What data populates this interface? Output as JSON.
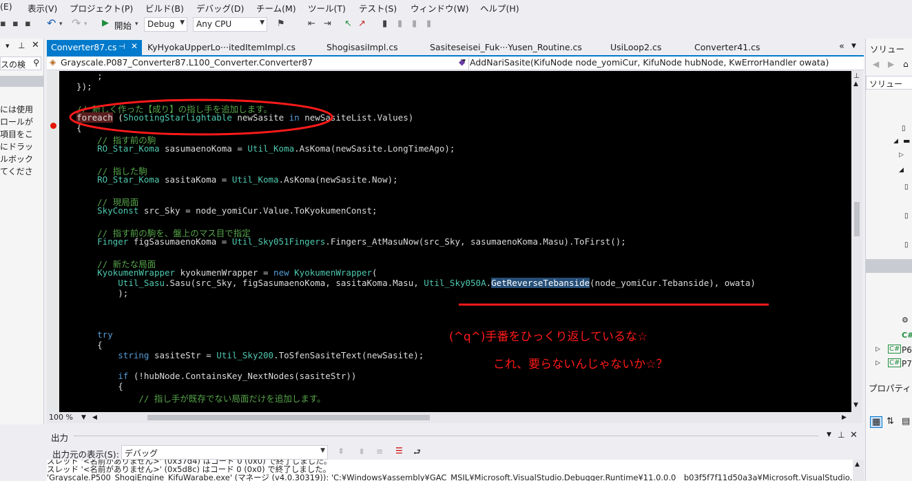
{
  "menu": {
    "items": [
      "(E)",
      "表示(V)",
      "プロジェクト(P)",
      "ビルド(B)",
      "デバッグ(D)",
      "チーム(M)",
      "ツール(T)",
      "テスト(S)",
      "ウィンドウ(W)",
      "ヘルプ(H)"
    ]
  },
  "toolbar": {
    "start_label": "開始",
    "config_value": "Debug",
    "platform_value": "Any CPU"
  },
  "left_panel": {
    "search_text": "スの検",
    "lines": [
      "には使用",
      "ロールが",
      "項目をこ",
      "にドラッ",
      "ルボック",
      "てくださ"
    ]
  },
  "tabs": [
    {
      "label": "Converter87.cs",
      "active": true
    },
    {
      "label": "KyHyokaUpperLo···itedItemImpl.cs",
      "active": false
    },
    {
      "label": "ShogisasiImpl.cs",
      "active": false
    },
    {
      "label": "Sasiteseisei_Fuk···Yusen_Routine.cs",
      "active": false
    },
    {
      "label": "UsiLoop2.cs",
      "active": false
    },
    {
      "label": "Converter41.cs",
      "active": false
    }
  ],
  "navbar": {
    "class_path": "Grayscale.P087_Converter87.L100_Converter.Converter87",
    "method": "AddNariSasite(KifuNode node_yomiCur, KifuNode hubNode, KwErrorHandler owata)"
  },
  "code_lines": [
    {
      "t": "      ;",
      "c": ""
    },
    {
      "t": "  });",
      "c": ""
    },
    {
      "t": "",
      "c": ""
    },
    {
      "t": "  // 新しく作った【成り】の指し手を追加します。",
      "c": "cm"
    },
    {
      "t": "  foreach (ShootingStarlightable newSasite in newSasiteList.Values)",
      "c": "fe"
    },
    {
      "t": "  {",
      "c": ""
    },
    {
      "t": "      // 指す前の駒",
      "c": "cm"
    },
    {
      "t": "      RO_Star_Koma sasumaenoKoma = Util_Koma.AsKoma(newSasite.LongTimeAgo);",
      "c": "ty1"
    },
    {
      "t": "",
      "c": ""
    },
    {
      "t": "      // 指した駒",
      "c": "cm"
    },
    {
      "t": "      RO_Star_Koma sasitaKoma = Util_Koma.AsKoma(newSasite.Now);",
      "c": "ty2"
    },
    {
      "t": "",
      "c": ""
    },
    {
      "t": "      // 現局面",
      "c": "cm"
    },
    {
      "t": "      SkyConst src_Sky = node_yomiCur.Value.ToKyokumenConst;",
      "c": "ty3"
    },
    {
      "t": "",
      "c": ""
    },
    {
      "t": "      // 指す前の駒を、盤上のマス目で指定",
      "c": "cm"
    },
    {
      "t": "      Finger figSasumaenoKoma = Util_Sky051Fingers.Fingers_AtMasuNow(src_Sky, sasumaenoKoma.Masu).ToFirst();",
      "c": "ty4"
    },
    {
      "t": "",
      "c": ""
    },
    {
      "t": "      // 新たな局面",
      "c": "cm"
    },
    {
      "t": "      KyokumenWrapper kyokumenWrapper = new KyokumenWrapper(",
      "c": "ty5"
    },
    {
      "t": "          Util_Sasu.Sasu(src_Sky, figSasumaenoKoma, sasitaKoma.Masu, Util_Sky050A.GetReverseTebanside(node_yomiCur.Tebanside), owata)",
      "c": "ty6"
    },
    {
      "t": "          );",
      "c": ""
    },
    {
      "t": "",
      "c": ""
    },
    {
      "t": "",
      "c": ""
    },
    {
      "t": "",
      "c": ""
    },
    {
      "t": "      try",
      "c": "kw"
    },
    {
      "t": "      {",
      "c": ""
    },
    {
      "t": "          string sasiteStr = Util_Sky200.ToSfenSasiteText(newSasite);",
      "c": "ty7"
    },
    {
      "t": "",
      "c": ""
    },
    {
      "t": "          if (!hubNode.ContainsKey_NextNodes(sasiteStr))",
      "c": "kw2"
    },
    {
      "t": "          {",
      "c": ""
    },
    {
      "t": "              // 指し手が既存でない局面だけを追加します。",
      "c": "cm"
    }
  ],
  "annotations": {
    "line1": "(^q^)手番をひっくり返しているな☆",
    "line2": "これ、要らないんじゃないか☆？"
  },
  "zoom": "100 %",
  "output": {
    "title": "出力",
    "source_label": "出力元の表示(S):",
    "source_value": "デバッグ",
    "lines": [
      "スレッド '<名前がありません>' (0x37d4) はコード 0 (0x0) で終了しました。",
      "スレッド '<名前がありません>' (0x5d8c) はコード 0 (0x0) で終了しました。",
      "'Grayscale.P500_ShogiEngine_KifuWarabe.exe' (マネージ (v4.0.30319)): 'C:¥Windows¥assembly¥GAC_MSIL¥Microsoft.VisualStudio.Debugger.Runtime¥11.0.0.0__b03f5f7f11d50a3a¥Microsoft.VisualStudio.Debu"
    ]
  },
  "right_panel": {
    "title1": "ソリュー",
    "title2": "ソリュー",
    "item_p6": "P6",
    "item_p7": "P7",
    "cs_label": "C#",
    "props_title": "プロパティ"
  },
  "colors": {
    "accent": "#007acc",
    "annotation": "#ff1a1a",
    "comment": "#57a64a",
    "keyword": "#569cd6",
    "type": "#4ec9b0"
  }
}
